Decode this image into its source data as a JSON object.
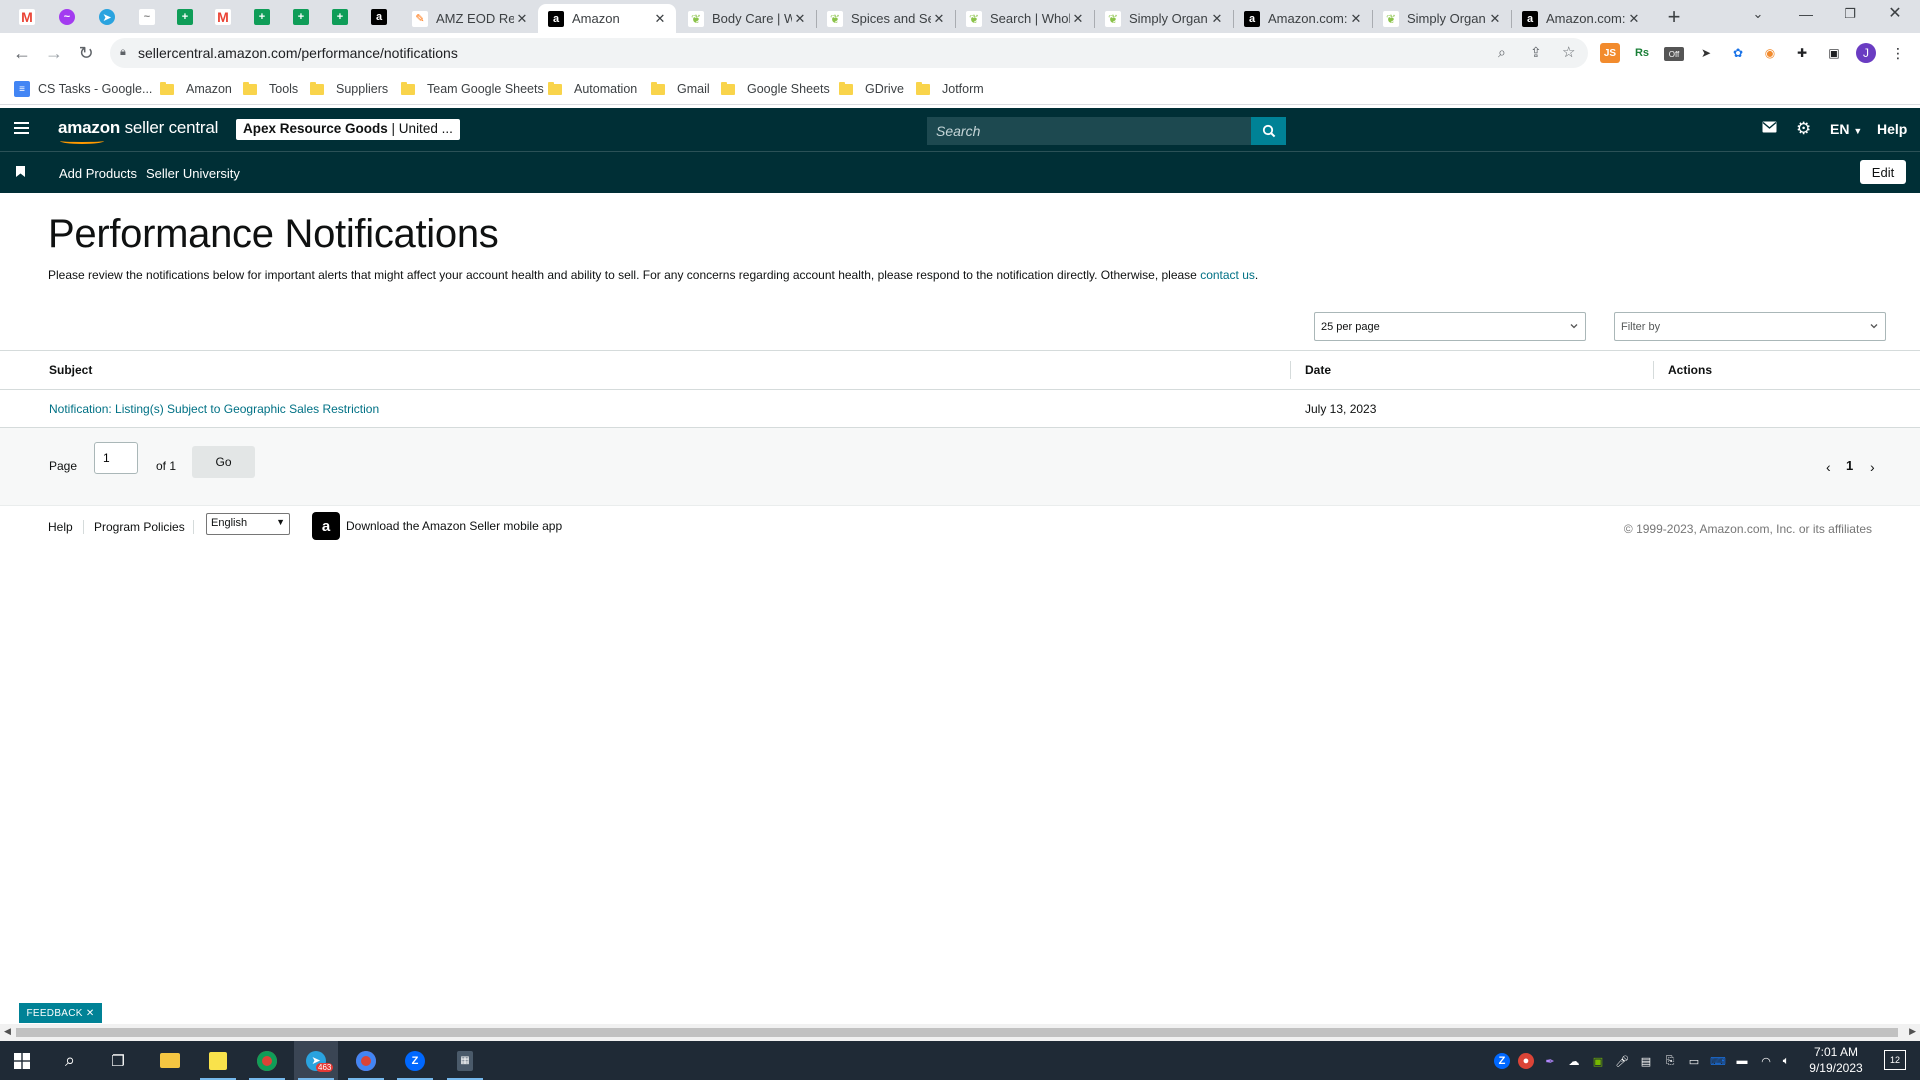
{
  "browser": {
    "tabs": [
      {
        "title": "AMZ EOD Rep",
        "active": false
      },
      {
        "title": "Amazon",
        "active": true
      },
      {
        "title": "Body Care | W",
        "active": false
      },
      {
        "title": "Spices and Se",
        "active": false
      },
      {
        "title": "Search | Whol",
        "active": false
      },
      {
        "title": "Simply Organ",
        "active": false
      },
      {
        "title": "Amazon.com:",
        "active": false
      },
      {
        "title": "Simply Organ",
        "active": false
      },
      {
        "title": "Amazon.com:",
        "active": false
      }
    ],
    "url": "sellercentral.amazon.com/performance/notifications",
    "bookmarks": [
      "CS Tasks - Google...",
      "Amazon",
      "Tools",
      "Suppliers",
      "Team Google Sheets",
      "Automation",
      "Gmail",
      "Google Sheets",
      "GDrive",
      "Jotform"
    ],
    "profile_initial": "J",
    "ext_off_label": "Off"
  },
  "header": {
    "logo_amazon": "amazon",
    "logo_rest": " seller central",
    "account_name": "Apex Resource Goods",
    "account_region": " | United ...",
    "search_placeholder": "Search",
    "language": "EN",
    "help": "Help"
  },
  "subnav": {
    "links": [
      "Add Products",
      "Seller University"
    ],
    "edit": "Edit"
  },
  "main": {
    "title": "Performance Notifications",
    "intro": "Please review the notifications below for important alerts that might affect your account health and ability to sell. For any concerns regarding account health, please respond to the notification directly. Otherwise, please ",
    "intro_link": "contact us",
    "intro_end": ".",
    "per_page": "25 per page",
    "filter_placeholder": "Filter by",
    "columns": {
      "subject": "Subject",
      "date": "Date",
      "actions": "Actions"
    },
    "rows": [
      {
        "subject": "Notification: Listing(s) Subject to Geographic Sales Restriction",
        "date": "July 13, 2023"
      }
    ],
    "pager": {
      "page_label": "Page",
      "page_value": "1",
      "of_label": "of 1",
      "go": "Go",
      "current": "1"
    }
  },
  "footer": {
    "help": "Help",
    "policies": "Program Policies",
    "language": "English",
    "app_text": "Download the Amazon Seller mobile app",
    "copyright": "© 1999-2023, Amazon.com, Inc. or its affiliates"
  },
  "feedback": "FEEDBACK",
  "taskbar": {
    "time": "7:01 AM",
    "date": "9/19/2023",
    "telegram_badge": "463",
    "notification_count": "12"
  },
  "colors": {
    "header_bg": "#002f36",
    "link": "#007185",
    "accent": "#008296"
  }
}
